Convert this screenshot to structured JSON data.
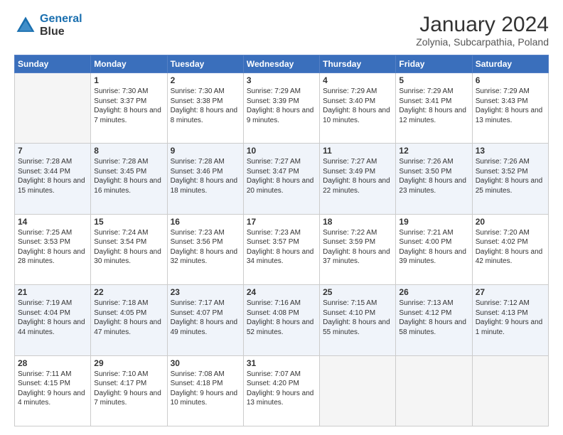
{
  "header": {
    "logo_line1": "General",
    "logo_line2": "Blue",
    "title": "January 2024",
    "subtitle": "Zolynia, Subcarpathia, Poland"
  },
  "days_of_week": [
    "Sunday",
    "Monday",
    "Tuesday",
    "Wednesday",
    "Thursday",
    "Friday",
    "Saturday"
  ],
  "weeks": [
    [
      {
        "day": "",
        "sunrise": "",
        "sunset": "",
        "daylight": ""
      },
      {
        "day": "1",
        "sunrise": "Sunrise: 7:30 AM",
        "sunset": "Sunset: 3:37 PM",
        "daylight": "Daylight: 8 hours and 7 minutes."
      },
      {
        "day": "2",
        "sunrise": "Sunrise: 7:30 AM",
        "sunset": "Sunset: 3:38 PM",
        "daylight": "Daylight: 8 hours and 8 minutes."
      },
      {
        "day": "3",
        "sunrise": "Sunrise: 7:29 AM",
        "sunset": "Sunset: 3:39 PM",
        "daylight": "Daylight: 8 hours and 9 minutes."
      },
      {
        "day": "4",
        "sunrise": "Sunrise: 7:29 AM",
        "sunset": "Sunset: 3:40 PM",
        "daylight": "Daylight: 8 hours and 10 minutes."
      },
      {
        "day": "5",
        "sunrise": "Sunrise: 7:29 AM",
        "sunset": "Sunset: 3:41 PM",
        "daylight": "Daylight: 8 hours and 12 minutes."
      },
      {
        "day": "6",
        "sunrise": "Sunrise: 7:29 AM",
        "sunset": "Sunset: 3:43 PM",
        "daylight": "Daylight: 8 hours and 13 minutes."
      }
    ],
    [
      {
        "day": "7",
        "sunrise": "Sunrise: 7:28 AM",
        "sunset": "Sunset: 3:44 PM",
        "daylight": "Daylight: 8 hours and 15 minutes."
      },
      {
        "day": "8",
        "sunrise": "Sunrise: 7:28 AM",
        "sunset": "Sunset: 3:45 PM",
        "daylight": "Daylight: 8 hours and 16 minutes."
      },
      {
        "day": "9",
        "sunrise": "Sunrise: 7:28 AM",
        "sunset": "Sunset: 3:46 PM",
        "daylight": "Daylight: 8 hours and 18 minutes."
      },
      {
        "day": "10",
        "sunrise": "Sunrise: 7:27 AM",
        "sunset": "Sunset: 3:47 PM",
        "daylight": "Daylight: 8 hours and 20 minutes."
      },
      {
        "day": "11",
        "sunrise": "Sunrise: 7:27 AM",
        "sunset": "Sunset: 3:49 PM",
        "daylight": "Daylight: 8 hours and 22 minutes."
      },
      {
        "day": "12",
        "sunrise": "Sunrise: 7:26 AM",
        "sunset": "Sunset: 3:50 PM",
        "daylight": "Daylight: 8 hours and 23 minutes."
      },
      {
        "day": "13",
        "sunrise": "Sunrise: 7:26 AM",
        "sunset": "Sunset: 3:52 PM",
        "daylight": "Daylight: 8 hours and 25 minutes."
      }
    ],
    [
      {
        "day": "14",
        "sunrise": "Sunrise: 7:25 AM",
        "sunset": "Sunset: 3:53 PM",
        "daylight": "Daylight: 8 hours and 28 minutes."
      },
      {
        "day": "15",
        "sunrise": "Sunrise: 7:24 AM",
        "sunset": "Sunset: 3:54 PM",
        "daylight": "Daylight: 8 hours and 30 minutes."
      },
      {
        "day": "16",
        "sunrise": "Sunrise: 7:23 AM",
        "sunset": "Sunset: 3:56 PM",
        "daylight": "Daylight: 8 hours and 32 minutes."
      },
      {
        "day": "17",
        "sunrise": "Sunrise: 7:23 AM",
        "sunset": "Sunset: 3:57 PM",
        "daylight": "Daylight: 8 hours and 34 minutes."
      },
      {
        "day": "18",
        "sunrise": "Sunrise: 7:22 AM",
        "sunset": "Sunset: 3:59 PM",
        "daylight": "Daylight: 8 hours and 37 minutes."
      },
      {
        "day": "19",
        "sunrise": "Sunrise: 7:21 AM",
        "sunset": "Sunset: 4:00 PM",
        "daylight": "Daylight: 8 hours and 39 minutes."
      },
      {
        "day": "20",
        "sunrise": "Sunrise: 7:20 AM",
        "sunset": "Sunset: 4:02 PM",
        "daylight": "Daylight: 8 hours and 42 minutes."
      }
    ],
    [
      {
        "day": "21",
        "sunrise": "Sunrise: 7:19 AM",
        "sunset": "Sunset: 4:04 PM",
        "daylight": "Daylight: 8 hours and 44 minutes."
      },
      {
        "day": "22",
        "sunrise": "Sunrise: 7:18 AM",
        "sunset": "Sunset: 4:05 PM",
        "daylight": "Daylight: 8 hours and 47 minutes."
      },
      {
        "day": "23",
        "sunrise": "Sunrise: 7:17 AM",
        "sunset": "Sunset: 4:07 PM",
        "daylight": "Daylight: 8 hours and 49 minutes."
      },
      {
        "day": "24",
        "sunrise": "Sunrise: 7:16 AM",
        "sunset": "Sunset: 4:08 PM",
        "daylight": "Daylight: 8 hours and 52 minutes."
      },
      {
        "day": "25",
        "sunrise": "Sunrise: 7:15 AM",
        "sunset": "Sunset: 4:10 PM",
        "daylight": "Daylight: 8 hours and 55 minutes."
      },
      {
        "day": "26",
        "sunrise": "Sunrise: 7:13 AM",
        "sunset": "Sunset: 4:12 PM",
        "daylight": "Daylight: 8 hours and 58 minutes."
      },
      {
        "day": "27",
        "sunrise": "Sunrise: 7:12 AM",
        "sunset": "Sunset: 4:13 PM",
        "daylight": "Daylight: 9 hours and 1 minute."
      }
    ],
    [
      {
        "day": "28",
        "sunrise": "Sunrise: 7:11 AM",
        "sunset": "Sunset: 4:15 PM",
        "daylight": "Daylight: 9 hours and 4 minutes."
      },
      {
        "day": "29",
        "sunrise": "Sunrise: 7:10 AM",
        "sunset": "Sunset: 4:17 PM",
        "daylight": "Daylight: 9 hours and 7 minutes."
      },
      {
        "day": "30",
        "sunrise": "Sunrise: 7:08 AM",
        "sunset": "Sunset: 4:18 PM",
        "daylight": "Daylight: 9 hours and 10 minutes."
      },
      {
        "day": "31",
        "sunrise": "Sunrise: 7:07 AM",
        "sunset": "Sunset: 4:20 PM",
        "daylight": "Daylight: 9 hours and 13 minutes."
      },
      {
        "day": "",
        "sunrise": "",
        "sunset": "",
        "daylight": ""
      },
      {
        "day": "",
        "sunrise": "",
        "sunset": "",
        "daylight": ""
      },
      {
        "day": "",
        "sunrise": "",
        "sunset": "",
        "daylight": ""
      }
    ]
  ]
}
